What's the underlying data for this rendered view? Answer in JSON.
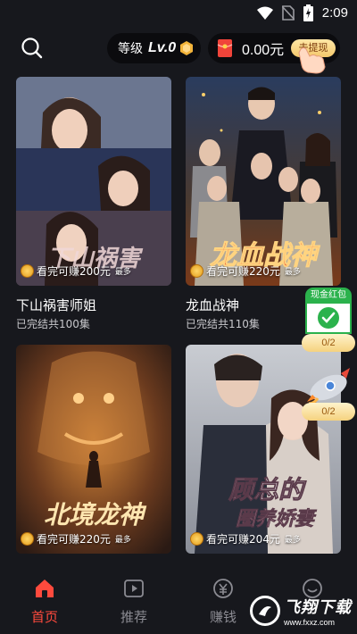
{
  "status_bar": {
    "time": "2:09"
  },
  "header": {
    "level_label": "等级",
    "level_value": "Lv.0",
    "cash_amount": "0.00元",
    "withdraw_label": "去提现"
  },
  "dramas": [
    {
      "title": "下山祸害师姐",
      "episodes": "已完结共100集",
      "earn": "看完可赚200元",
      "earn_max": "最多",
      "poster_text": "下山祸害师姐"
    },
    {
      "title": "龙血战神",
      "episodes": "已完结共110集",
      "earn": "看完可赚220元",
      "earn_max": "最多",
      "poster_text": "龙血战神"
    },
    {
      "title": "",
      "episodes": "",
      "earn": "看完可赚220元",
      "earn_max": "最多",
      "poster_text": "北境龙神"
    },
    {
      "title": "",
      "episodes": "",
      "earn": "看完可赚204元",
      "earn_max": "最多",
      "poster_text": "顾总的圈养娇妻"
    }
  ],
  "floating": {
    "red_packet_label": "现金红包",
    "red_packet_progress": "0/2",
    "rocket_progress": "0/2"
  },
  "bottom_nav": [
    {
      "label": "首页",
      "active": true,
      "icon": "home-icon"
    },
    {
      "label": "推荐",
      "active": false,
      "icon": "play-icon"
    },
    {
      "label": "赚钱",
      "active": false,
      "icon": "yuan-icon"
    },
    {
      "label": "",
      "active": false,
      "icon": "smile-icon"
    }
  ],
  "watermark": {
    "main": "飞翔下载",
    "sub": "www.fxxz.com"
  },
  "colors": {
    "accent": "#ff4a3d",
    "background": "#17181d",
    "gold": "#f4c86c",
    "green": "#2bb24c"
  }
}
